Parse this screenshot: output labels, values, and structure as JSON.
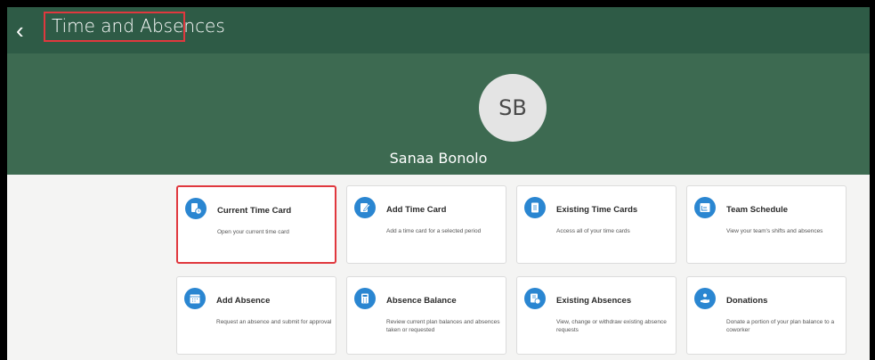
{
  "header": {
    "title": "Time and Absences",
    "back_glyph": "‹"
  },
  "profile": {
    "initials": "SB",
    "name": "Sanaa Bonolo"
  },
  "cards": [
    {
      "title": "Current Time Card",
      "desc": "Open your current time card",
      "icon": "time-card-icon"
    },
    {
      "title": "Add Time Card",
      "desc": "Add a time card for a selected period",
      "icon": "add-time-card-icon"
    },
    {
      "title": "Existing Time Cards",
      "desc": "Access all of your time cards",
      "icon": "time-cards-list-icon"
    },
    {
      "title": "Team Schedule",
      "desc": "View your team's shifts and absences",
      "icon": "team-schedule-icon"
    },
    {
      "title": "Add Absence",
      "desc": "Request an absence and submit for approval",
      "icon": "calendar-add-icon"
    },
    {
      "title": "Absence Balance",
      "desc": "Review current plan balances and absences taken or requested",
      "icon": "calculator-icon"
    },
    {
      "title": "Existing Absences",
      "desc": "View, change or withdraw existing absence requests",
      "icon": "existing-absences-icon"
    },
    {
      "title": "Donations",
      "desc": "Donate a portion of your plan balance to a coworker",
      "icon": "donation-icon"
    }
  ],
  "colors": {
    "header": "#2e5b46",
    "hero": "#3d6a51",
    "icon_blue": "#2a86d1",
    "highlight": "#e0383e"
  }
}
